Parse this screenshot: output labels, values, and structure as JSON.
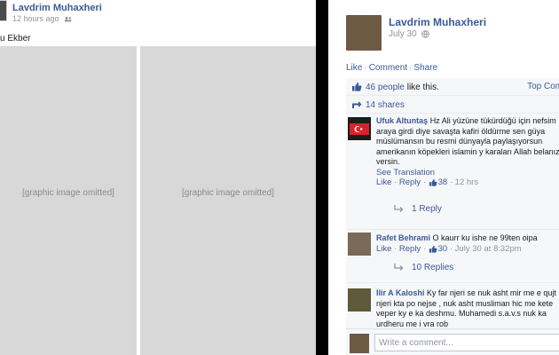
{
  "left_post": {
    "author": "Lavdrim Muhaxheri",
    "time": "12 hours ago",
    "caption": "u Ekber",
    "photo_note": "[graphic image omitted]"
  },
  "right_post": {
    "author": "Lavdrim Muhaxheri",
    "time": "July 30",
    "actions": {
      "like": "Like",
      "comment": "Comment",
      "share": "Share"
    },
    "likes": {
      "count": "46 people",
      "text": "like this.",
      "top_comments": "Top Comme"
    },
    "shares": "14 shares"
  },
  "comments": [
    {
      "name": "Ufuk Altuntaş",
      "text": "Hz Ali yüzüne tükürdüğü için nefsim araya girdi diye savaşta kafiri öldürme sen güya müslümansın bu resmi dünyayla paylaşıyorsun amerikanın köpekleri islamin y karaları Allah belanızı versin.",
      "see_translation": "See Translation",
      "like": "Like",
      "reply": "Reply",
      "likes": "38",
      "time": "12 hrs",
      "replies": "1 Reply"
    },
    {
      "name": "Rafet Behrami",
      "text": "O kaurr ku ishe ne 99ten oipa",
      "like": "Like",
      "reply": "Reply",
      "likes": "30",
      "time": "July 30 at 8:32pm",
      "replies": "10 Replies"
    },
    {
      "name": "Ilir A Kaloshi",
      "text": "Ky far njeri se nuk asht mir me e qujt njeri kta po nejse , nuk asht musliman hic me kete veper ky e ka deshmu. Muhamedi s.a.v.s nuk ka urdheru me i vra rob"
    }
  ],
  "write_comment": {
    "placeholder": "Write a comment..."
  },
  "colors": {
    "link": "#3b5998",
    "muted": "#90949c",
    "ufi_bg": "#f6f7f9"
  }
}
